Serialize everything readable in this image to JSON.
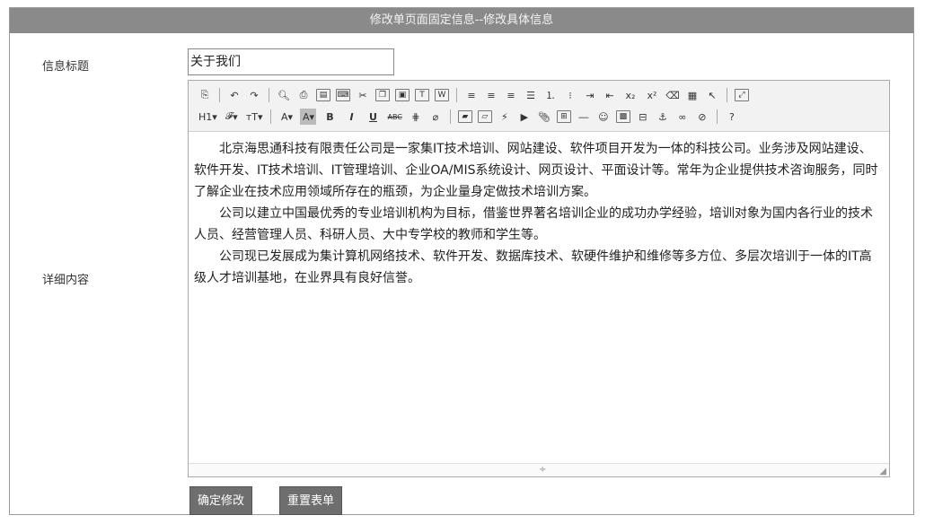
{
  "header": {
    "title": "修改单页面固定信息--修改具体信息"
  },
  "form": {
    "title_label": "信息标题",
    "title_value": "关于我们",
    "content_label": "详细内容"
  },
  "toolbar": {
    "row1": [
      "source-icon",
      "undo-icon",
      "redo-icon",
      "preview-icon",
      "print-icon",
      "template-icon",
      "paste-code-icon",
      "cut-icon",
      "copy-icon",
      "paste-icon",
      "paste-text-icon",
      "paste-word-icon",
      "align-left-icon",
      "align-center-icon",
      "align-right-icon",
      "align-justify-icon",
      "ordered-list-icon",
      "unordered-list-icon",
      "indent-icon",
      "outdent-icon",
      "subscript-icon",
      "superscript-icon",
      "clear-format-icon",
      "select-all-icon",
      "pointer-icon",
      "fullscreen-icon"
    ],
    "row2_labels": {
      "heading": "H1",
      "font": "𝓕",
      "fontsize": "тT",
      "forecolor": "A",
      "hilite": "A",
      "bold": "B",
      "italic": "I",
      "underline": "U",
      "strike": "ABC"
    }
  },
  "editor": {
    "paragraphs": [
      "北京海思通科技有限责任公司是一家集IT技术培训、网站建设、软件项目开发为一体的科技公司。业务涉及网站建设、软件开发、IT技术培训、IT管理培训、企业OA/MIS系统设计、网页设计、平面设计等。常年为企业提供技术咨询服务，同时了解企业在技术应用领域所存在的瓶颈，为企业量身定做技术培训方案。",
      "公司以建立中国最优秀的专业培训机构为目标，借鉴世界著名培训企业的成功办学经验，培训对象为国内各行业的技术人员、经营管理人员、科研人员、大中专学校的教师和学生等。",
      "公司现已发展成为集计算机网络技术、软件开发、数据库技术、软硬件维护和维修等多方位、多层次培训于一体的IT高级人才培训基地，在业界具有良好信誉。"
    ]
  },
  "buttons": {
    "submit": "确定修改",
    "reset": "重置表单"
  }
}
